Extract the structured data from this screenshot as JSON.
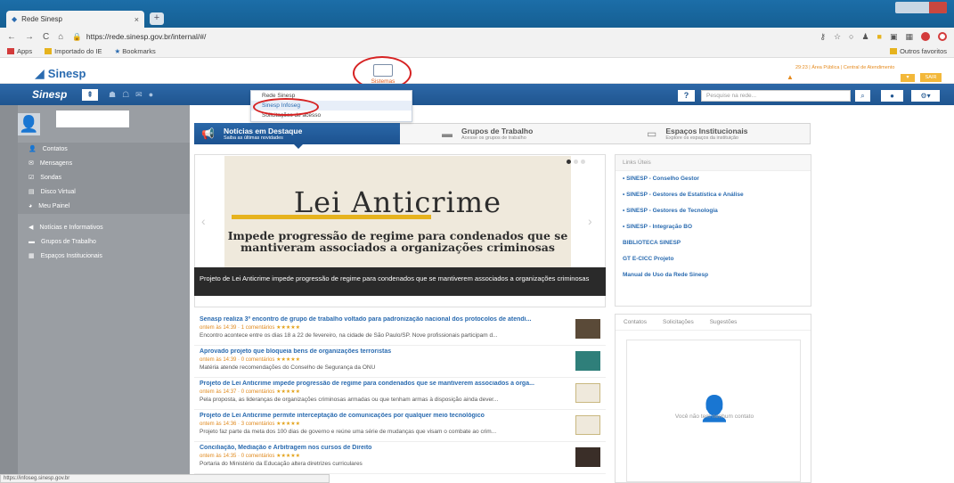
{
  "browser": {
    "tab_title": "Rede Sinesp",
    "tab_close": "×",
    "new_tab": "+",
    "nav_back": "←",
    "nav_forward": "→",
    "nav_reload": "C",
    "nav_home": "⌂",
    "url": "https://rede.sinesp.gov.br/internal/#/",
    "bookmarks": [
      "Apps",
      "Importado do IE",
      "Bookmarks"
    ],
    "other_bookmarks": "Outros favoritos",
    "status_url": "https://infoseg.sinesp.gov.br"
  },
  "header": {
    "logo": "Sinesp",
    "sistemas_label": "Sistemas",
    "right_info": "29:23 | Área Pública | Central de Atendimento",
    "sair": "SAIR"
  },
  "nav": {
    "logo": "Sinesp",
    "search_placeholder": "Pesquise na rede..."
  },
  "dropdown": {
    "items": [
      "Rede Sinesp",
      "Sinesp Infoseg",
      "Solicitações de acesso"
    ]
  },
  "sidebar": {
    "group1": [
      "Contatos",
      "Mensagens",
      "Sondas",
      "Disco Virtual",
      "Meu Painel"
    ],
    "group2": [
      "Notícias e Informativos",
      "Grupos de Trabalho",
      "Espaços Institucionais"
    ]
  },
  "center_tabs": [
    {
      "title": "Notícias em Destaque",
      "subtitle": "Saiba as últimas novidades"
    },
    {
      "title": "Grupos de Trabalho",
      "subtitle": "Acesse os grupos de trabalho"
    },
    {
      "title": "Espaços Institucionais",
      "subtitle": "Explore os espaços da instituição"
    }
  ],
  "slide": {
    "headline": "Lei Anticrime",
    "subline": "Impede progressão de regime para condenados que se mantiveram associados a organizações criminosas",
    "caption": "Projeto de Lei Anticrime impede progressão de regime para condenados que se mantiverem associados a organizações criminosas"
  },
  "news": [
    {
      "title": "Senasp realiza 3º encontro de grupo de trabalho voltado para padronização nacional dos protocolos de atendi...",
      "meta": "ontem às 14:39 · 1 comentários",
      "desc": "Encontro acontece entre os dias 18 a 22 de fevereiro, na cidade de São Paulo/SP. Nove profissionais participam d..."
    },
    {
      "title": "Aprovado projeto que bloqueia bens de organizações terroristas",
      "meta": "ontem às 14:39 · 0 comentários",
      "desc": "Matéria atende recomendações do Conselho de Segurança da ONU"
    },
    {
      "title": "Projeto de Lei Anticrime impede progressão de regime para condenados que se mantiverem associados a orga...",
      "meta": "ontem às 14:37 · 0 comentários",
      "desc": "Pela proposta, as lideranças de organizações criminosas armadas ou que tenham armas à disposição ainda dever..."
    },
    {
      "title": "Projeto de Lei Anticrime permite interceptação de comunicações por qualquer meio tecnológico",
      "meta": "ontem às 14:36 · 3 comentários",
      "desc": "Projeto faz parte da meta dos 100 dias de governo e reúne uma série de mudanças que visam o combate ao crim..."
    },
    {
      "title": "Conciliação, Mediação e Arbitragem nos cursos de Direito",
      "meta": "ontem às 14:35 · 0 comentários",
      "desc": "Portaria do Ministério da Educação altera diretrizes curriculares"
    }
  ],
  "stars": "★★★★★",
  "links": {
    "header": "Links Úteis",
    "items": [
      "• SINESP - Conselho Gestor",
      "• SINESP - Gestores de Estatística e Análise",
      "• SINESP - Gestores de Tecnologia",
      "• SINESP - Integração BO",
      "BIBLIOTECA SINESP",
      "GT E-CICC Projeto",
      "Manual de Uso da Rede Sinesp"
    ]
  },
  "contacts": {
    "tabs": [
      "Contatos",
      "Solicitações",
      "Sugestões"
    ],
    "empty": "Você não tem nenhum contato"
  }
}
